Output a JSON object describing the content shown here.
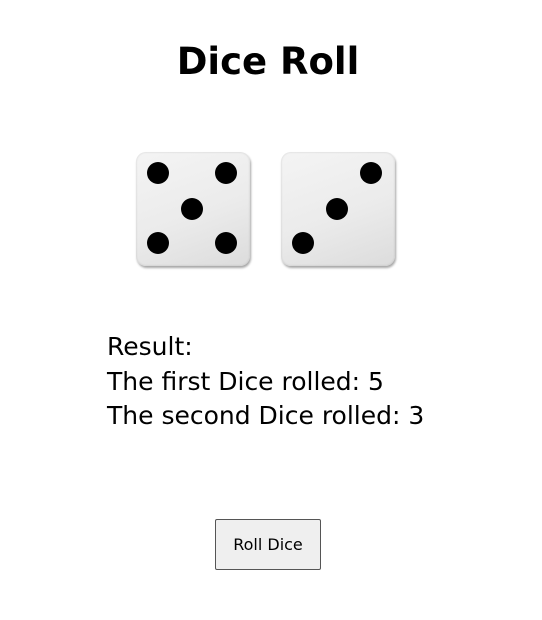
{
  "page": {
    "title": "Dice Roll"
  },
  "dice": [
    {
      "value": 5
    },
    {
      "value": 3
    }
  ],
  "result": {
    "heading": "Result:",
    "first": "The first Dice rolled: 5",
    "second": "The second Dice rolled: 3"
  },
  "controls": {
    "roll_label": "Roll Dice"
  }
}
